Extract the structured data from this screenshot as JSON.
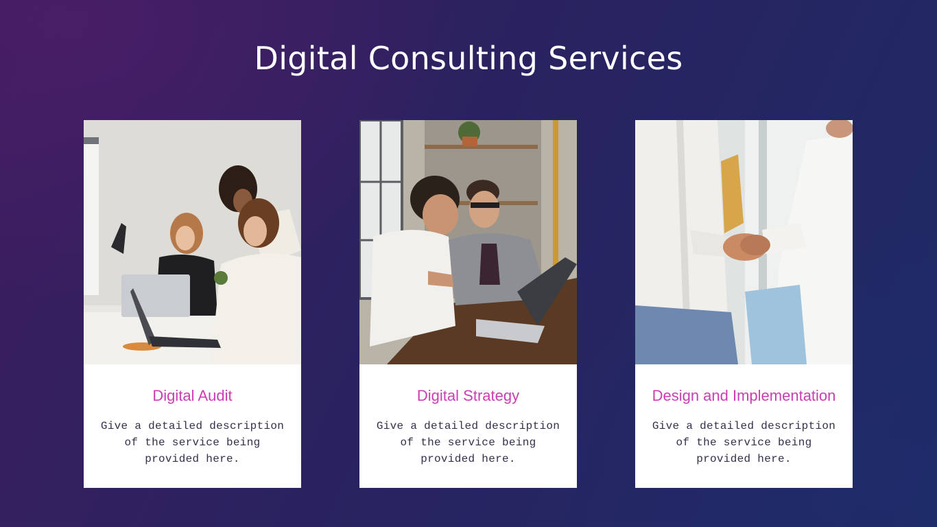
{
  "slide": {
    "title": "Digital Consulting Services",
    "accent_color": "#c93fb3",
    "background_colors": [
      "#3d1d5e",
      "#1d2b66"
    ]
  },
  "services": [
    {
      "title": "Digital Audit",
      "description": "Give a detailed description of the service being provided here.",
      "image": "team-working-on-laptops-photo"
    },
    {
      "title": "Digital Strategy",
      "description": "Give a detailed description of the service being provided here.",
      "image": "two-men-reviewing-laptop-photo"
    },
    {
      "title": "Design and Implementation",
      "description": "Give a detailed description of the service being provided here.",
      "image": "business-handshake-photo"
    }
  ]
}
